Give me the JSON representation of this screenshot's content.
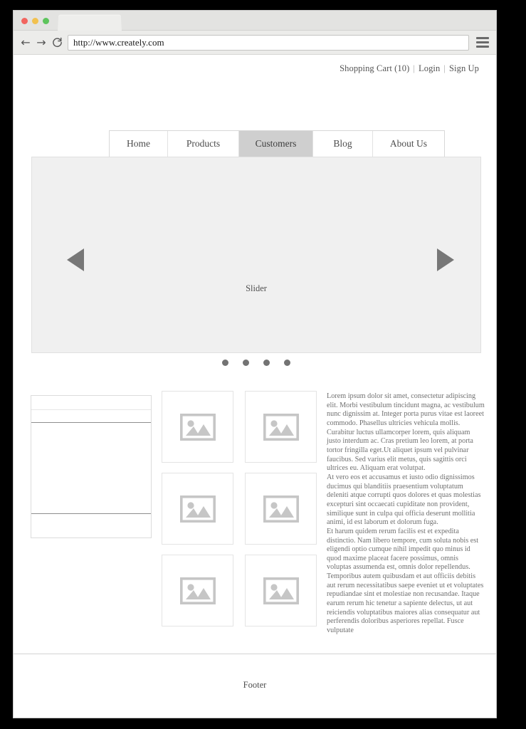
{
  "browser": {
    "url": "http://www.creately.com",
    "url_placeholder": "Search or type URL",
    "back_glyph": "←",
    "forward_glyph": "→",
    "reload_glyph": "↻",
    "traffic_lights": [
      "#f2655f",
      "#f2c14f",
      "#5dc45c"
    ]
  },
  "utility": {
    "cart": "Shopping Cart (10)",
    "separator": "|",
    "login": "Login",
    "signup": "Sign Up"
  },
  "nav": {
    "items": [
      {
        "label": "Home",
        "active": false,
        "width": 82
      },
      {
        "label": "Products",
        "active": false,
        "width": 100
      },
      {
        "label": "Customers",
        "active": true,
        "width": 104
      },
      {
        "label": "Blog",
        "active": false,
        "width": 84
      },
      {
        "label": "About Us",
        "active": false,
        "width": 100
      }
    ]
  },
  "slider": {
    "label": "Slider",
    "prev_arrow": "left-arrow",
    "next_arrow": "right-arrow",
    "dot_count": 4,
    "active_dot": 0,
    "background": "#f0f0f0",
    "arrow_color": "#777777"
  },
  "sidebar": {
    "rows": [
      "",
      "",
      "",
      ""
    ]
  },
  "thumbnails": {
    "count": 6,
    "placeholder_color": "#cccccc"
  },
  "article": {
    "paragraphs": [
      "Lorem ipsum dolor sit amet, consectetur adipiscing elit. Morbi vestibulum tincidunt magna, ac vestibulum nunc dignissim at. Integer porta purus vitae est laoreet commodo. Phasellus ultricies vehicula mollis. Curabitur luctus ullamcorper lorem, quis aliquam justo interdum ac. Cras pretium leo lorem, at porta tortor fringilla eget.Ut aliquet ipsum vel pulvinar faucibus. Sed varius elit metus, quis sagittis orci ultrices eu. Aliquam erat volutpat.",
      "At vero eos et accusamus et iusto odio dignissimos ducimus qui blanditiis praesentium voluptatum deleniti atque corrupti quos dolores et quas molestias excepturi sint occaecati cupiditate non provident, similique sunt in culpa qui officia deserunt mollitia animi, id est laborum et dolorum fuga.",
      "Et harum quidem rerum facilis est et expedita distinctio. Nam libero tempore, cum soluta nobis est eligendi optio cumque nihil impedit quo minus id quod maxime placeat facere possimus, omnis voluptas assumenda est, omnis dolor repellendus. Temporibus autem quibusdam et aut officiis debitis aut rerum necessitatibus saepe eveniet ut et voluptates repudiandae sint et molestiae non recusandae. Itaque earum rerum hic tenetur a sapiente delectus, ut aut reiciendis voluptatibus maiores alias consequatur aut perferendis doloribus asperiores repellat. Fusce vulputate"
    ]
  },
  "footer": {
    "label": "Footer"
  }
}
